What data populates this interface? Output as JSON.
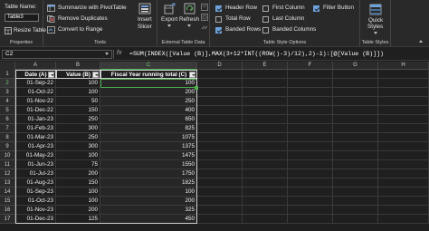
{
  "ribbon": {
    "properties": {
      "table_name_label": "Table Name:",
      "table_name_value": "Table3",
      "resize_label": "Resize Table",
      "group_label": "Properties"
    },
    "tools": {
      "summarize_label": "Summarize with PivotTable",
      "remove_dup_label": "Remove Duplicates",
      "convert_label": "Convert to Range",
      "insert_slicer_label_1": "Insert",
      "insert_slicer_label_2": "Slicer",
      "group_label": "Tools"
    },
    "external": {
      "export_label": "Export",
      "refresh_label": "Refresh",
      "group_label": "External Table Data"
    },
    "style_options": {
      "header_row": "Header Row",
      "total_row": "Total Row",
      "banded_rows": "Banded Rows",
      "first_column": "First Column",
      "last_column": "Last Column",
      "banded_columns": "Banded Columns",
      "filter_button": "Filter Button",
      "group_label": "Table Style Options"
    },
    "styles": {
      "quick_styles_1": "Quick",
      "quick_styles_2": "Styles",
      "group_label": "Table Styles"
    }
  },
  "formula_bar": {
    "name_box": "C2",
    "fx": "fx",
    "formula": "=SUM(INDEX([Value (B)],MAX(3+12*INT((ROW()-3)/12),2)-1):[@[Value (B)]])"
  },
  "grid": {
    "columns": [
      "A",
      "B",
      "C",
      "D",
      "E",
      "F",
      "G",
      "H"
    ],
    "rows": [
      "1",
      "2",
      "3",
      "4",
      "5",
      "6",
      "7",
      "8",
      "9",
      "10",
      "11",
      "12",
      "13",
      "14",
      "15",
      "16",
      "17"
    ],
    "headers": [
      "Date (A)",
      "Value (B)",
      "Fiscal Year running total (C)"
    ],
    "data": [
      [
        "01-Sep-22",
        "100",
        "100"
      ],
      [
        "01-Oct-22",
        "100",
        "200"
      ],
      [
        "01-Nov-22",
        "50",
        "250"
      ],
      [
        "01-Dec-22",
        "150",
        "400"
      ],
      [
        "01-Jan-23",
        "250",
        "650"
      ],
      [
        "01-Feb-23",
        "300",
        "825"
      ],
      [
        "01-Mar-23",
        "250",
        "1075"
      ],
      [
        "01-Apr-23",
        "300",
        "1375"
      ],
      [
        "01-May-23",
        "100",
        "1475"
      ],
      [
        "01-Jun-23",
        "75",
        "1550"
      ],
      [
        "01-Jul-23",
        "200",
        "1750"
      ],
      [
        "01-Aug-23",
        "150",
        "1825"
      ],
      [
        "01-Sep-23",
        "100",
        "100"
      ],
      [
        "01-Oct-23",
        "100",
        "200"
      ],
      [
        "01-Nov-23",
        "200",
        "325"
      ],
      [
        "01-Dec-23",
        "125",
        "450"
      ]
    ]
  }
}
